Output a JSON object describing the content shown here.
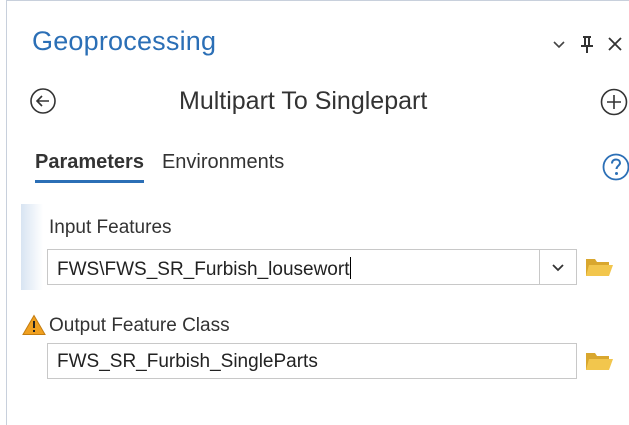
{
  "pane": {
    "title": "Geoprocessing",
    "controls": [
      "chevron-down-icon",
      "pin-icon",
      "close-icon"
    ]
  },
  "tool": {
    "title": "Multipart To Singlepart",
    "nav_icons": [
      "back-arrow-icon",
      "add-icon"
    ]
  },
  "tabs": [
    {
      "label": "Parameters",
      "active": true
    },
    {
      "label": "Environments",
      "active": false
    }
  ],
  "help_icon": "help-icon",
  "params": {
    "input": {
      "label": "Input Features",
      "value": "FWS\\FWS_SR_Furbish_lousewort",
      "has_dropdown": true,
      "browse_icon": "folder-icon"
    },
    "output": {
      "label": "Output Feature Class",
      "value": "FWS_SR_Furbish_SingleParts",
      "status_icon": "warning-icon",
      "browse_icon": "folder-icon"
    }
  },
  "colors": {
    "accent": "#2b6fb6",
    "folder": "#e8b93c",
    "warning": "#f0a020"
  }
}
